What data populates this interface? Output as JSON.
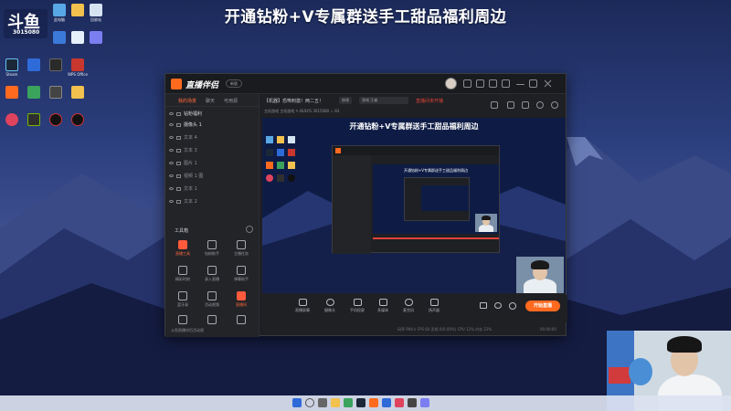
{
  "banner": {
    "text": "开通钻粉+V专属群送手工甜品福利周边"
  },
  "desktop": {
    "logo_glyph": "斗鱼",
    "room_number": "3015080",
    "icon_labels": [
      "此电脑",
      "",
      "回收站",
      "",
      "Steam",
      "",
      "",
      "WPS Office",
      "",
      "",
      "",
      "",
      "",
      "",
      "",
      ""
    ]
  },
  "app": {
    "name": "直播伴侣",
    "version_pill": "新版",
    "sidebar": {
      "tabs": [
        {
          "label": "我的场景",
          "active": true
        },
        {
          "label": "聊天",
          "active": false
        },
        {
          "label": "可用源",
          "active": false
        }
      ],
      "scenes": [
        {
          "label": "钻粉福利",
          "on": true
        },
        {
          "label": "摄像头 1",
          "on": true
        },
        {
          "label": "文本 4",
          "on": false
        },
        {
          "label": "文本 3",
          "on": false
        },
        {
          "label": "图片 1",
          "on": false
        },
        {
          "label": "视频 1 图",
          "on": false
        },
        {
          "label": "文本 1",
          "on": false
        },
        {
          "label": "文本 2",
          "on": false
        }
      ],
      "tools_title": "工具箱",
      "tools": [
        {
          "label": "直播工具",
          "hot": true
        },
        {
          "label": "钻粉助手",
          "hot": false
        },
        {
          "label": "主播任务",
          "hot": false
        },
        {
          "label": "精彩时刻",
          "hot": false
        },
        {
          "label": "录入直播",
          "hot": false
        },
        {
          "label": "弹幕助手",
          "hot": false
        },
        {
          "label": "蓝牙录",
          "hot": false
        },
        {
          "label": "活动视频",
          "hot": false
        },
        {
          "label": "直播间",
          "hot": true
        },
        {
          "label": "",
          "hot": false
        },
        {
          "label": "斗鱼直播伴侣活动视",
          "hot": false
        },
        {
          "label": "",
          "hot": false
        }
      ]
    },
    "header": {
      "room_title": "【机器】恐怖刺激！两二五！",
      "tag1": "修改",
      "tag2": "游戏·王者",
      "red_notice": "直播间未开播",
      "row2": "主机游戏  主机游戏  ✎   BULYG   3015080   ♨ 83"
    },
    "preview": {
      "title": "开通钻粉+V专属群送手工甜品福利周边"
    },
    "bottom_bar": [
      "直播屏幕",
      "摄像头",
      "手机投屏",
      "多媒体",
      "麦克风",
      "扬声器"
    ],
    "go_live": "开始直播",
    "status": {
      "left": "码率 994 k     FPS 60     丢帧 0(0.00%)     CPU 12%     内存 23%",
      "time": "00:00:00"
    }
  },
  "colors": {
    "accent": "#ff6a1f",
    "alert": "#e2433a",
    "window_bg": "#1f2024"
  }
}
